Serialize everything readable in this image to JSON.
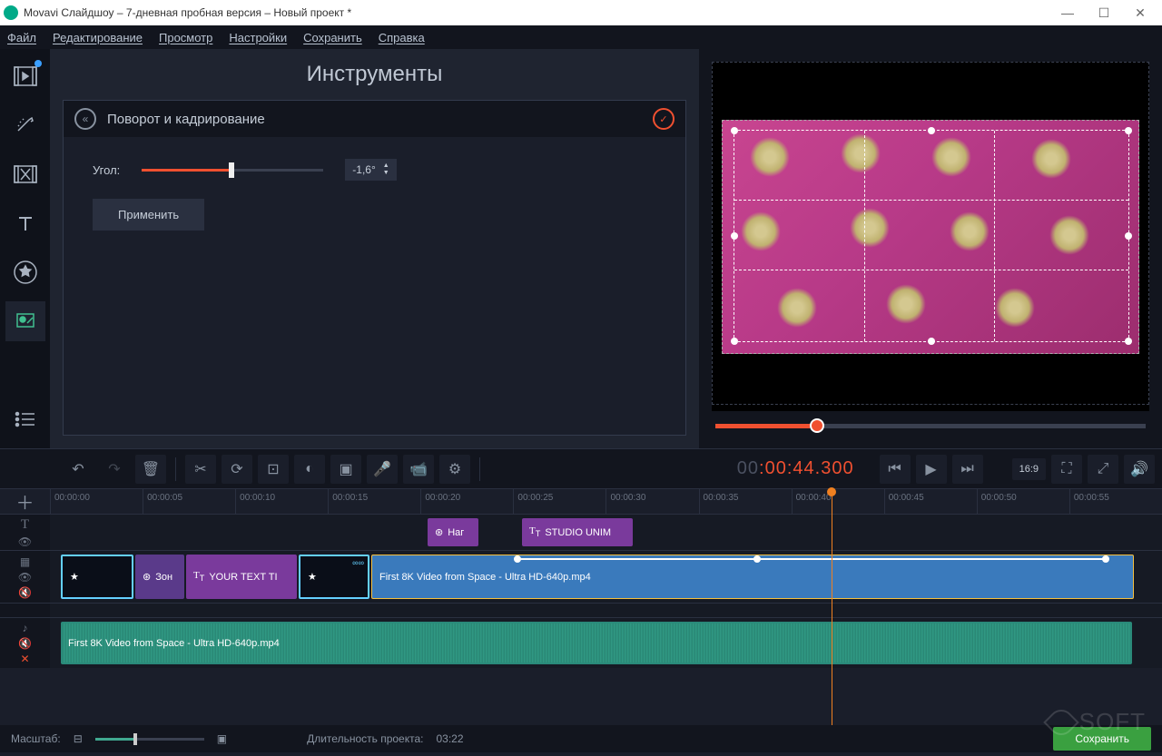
{
  "window": {
    "title": "Movavi Слайдшоу – 7-дневная пробная версия – Новый проект *"
  },
  "menu": {
    "file": "Файл",
    "edit": "Редактирование",
    "view": "Просмотр",
    "settings": "Настройки",
    "save": "Сохранить",
    "help": "Справка"
  },
  "tools": {
    "title": "Инструменты",
    "section": "Поворот и кадрирование",
    "angle_label": "Угол:",
    "angle_value": "-1,6°",
    "apply": "Применить"
  },
  "timecode": {
    "gray": "00",
    "orange1": ":00:",
    "orange2": "44.300"
  },
  "aspect": "16:9",
  "ruler": [
    "00:00:00",
    "00:00:05",
    "00:00:10",
    "00:00:15",
    "00:00:20",
    "00:00:25",
    "00:00:30",
    "00:00:35",
    "00:00:40",
    "00:00:45",
    "00:00:50",
    "00:00:55"
  ],
  "titles": {
    "clip1": "Наг",
    "clip2": "STUDIO UNIM"
  },
  "video": {
    "zone": "Зон",
    "your_text": "YOUR TEXT TI",
    "main": "First 8K Video from Space - Ultra HD-640p.mp4"
  },
  "audio": {
    "main": "First 8K Video from Space - Ultra HD-640p.mp4"
  },
  "status": {
    "zoom_label": "Масштаб:",
    "duration_label": "Длительность проекта:",
    "duration_value": "03:22",
    "save": "Сохранить"
  },
  "watermark": "SOFT"
}
